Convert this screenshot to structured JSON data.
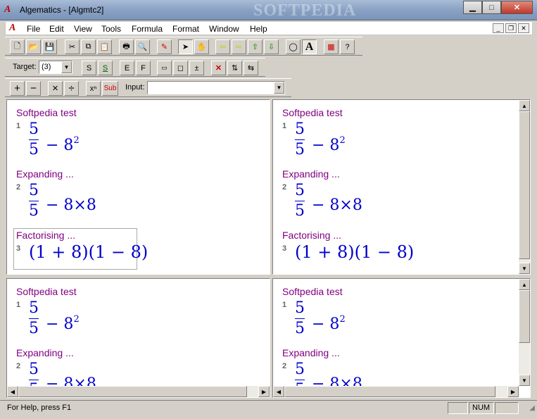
{
  "window": {
    "title": "Algematics - [Algmtc2]",
    "watermark": "SOFTPEDIA"
  },
  "menu": [
    "File",
    "Edit",
    "View",
    "Tools",
    "Formula",
    "Format",
    "Window",
    "Help"
  ],
  "toolbar2": {
    "target_label": "Target:",
    "target_value": "(3)",
    "s1": "S",
    "s2": "S",
    "e": "E",
    "f": "F",
    "pm": "±"
  },
  "toolbar3": {
    "plus": "+",
    "minus": "−",
    "times": "×",
    "divide": "÷",
    "sub": "Sub",
    "input_label": "Input:",
    "input_value": ""
  },
  "blocks": {
    "b1": {
      "title": "Softpedia test",
      "num": "1",
      "numer": "5",
      "denom": "5",
      "rest_a": "− 8",
      "sup": "2"
    },
    "b2": {
      "title": "Expanding ...",
      "num": "2",
      "numer": "5",
      "denom": "5",
      "rest_a": "− 8×8"
    },
    "b3": {
      "title": "Factorising ...",
      "num": "3",
      "expr": "(1 + 8)(1 − 8)"
    }
  },
  "status": {
    "help": "For Help, press F1",
    "num": "NUM"
  }
}
